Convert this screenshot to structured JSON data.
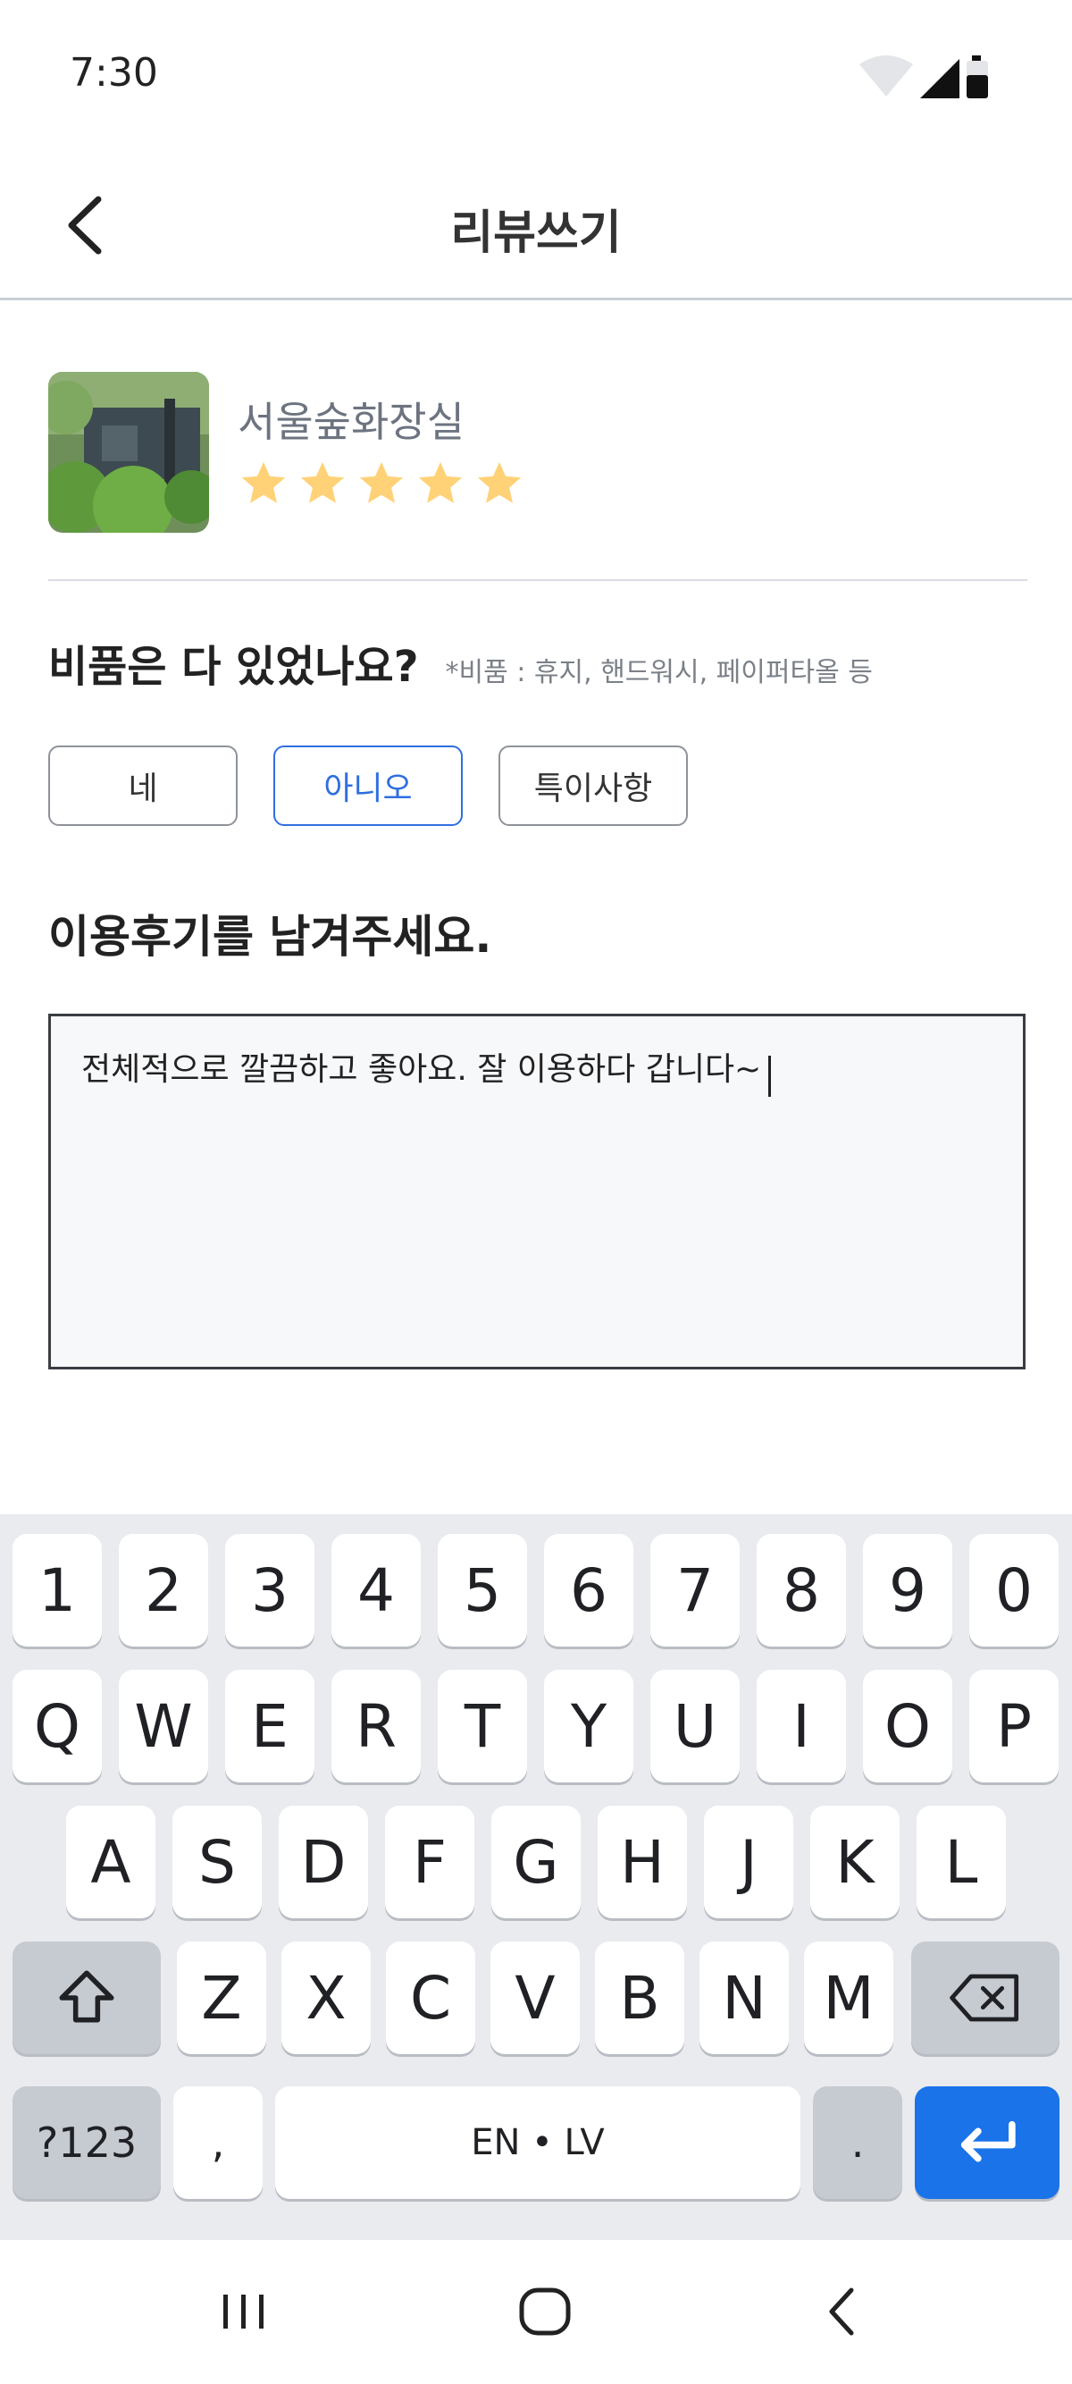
{
  "status_bar": {
    "time": "7:30"
  },
  "header": {
    "title": "리뷰쓰기"
  },
  "place": {
    "name": "서울숲화장실",
    "rating": 5,
    "max_rating": 5,
    "star_color": "#ffd278"
  },
  "question": {
    "title": "비품은 다 있었나요?",
    "note": "*비품 : 휴지, 핸드워시, 페이퍼타올 등",
    "options": [
      "네",
      "아니오",
      "특이사항"
    ],
    "selected": "아니오"
  },
  "review": {
    "title": "이용후기를 남겨주세요.",
    "text": "전체적으로 깔끔하고 좋아요. 잘 이용하다 갑니다~"
  },
  "keyboard": {
    "row_numbers": [
      "1",
      "2",
      "3",
      "4",
      "5",
      "6",
      "7",
      "8",
      "9",
      "0"
    ],
    "row_top": [
      "Q",
      "W",
      "E",
      "R",
      "T",
      "Y",
      "U",
      "I",
      "O",
      "P"
    ],
    "row_middle": [
      "A",
      "S",
      "D",
      "F",
      "G",
      "H",
      "J",
      "K",
      "L"
    ],
    "row_bottom": [
      "Z",
      "X",
      "C",
      "V",
      "B",
      "N",
      "M"
    ],
    "symbols_key": "?123",
    "comma_key": ",",
    "space_key": "EN • LV",
    "period_key": ".",
    "accent_color": "#1a73e8"
  }
}
